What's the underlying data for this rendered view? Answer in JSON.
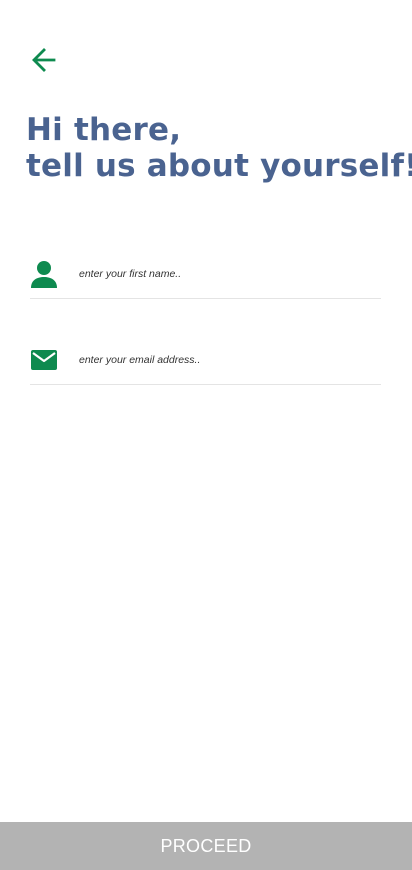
{
  "header": {
    "back_icon": "arrow-left-icon"
  },
  "heading": {
    "line1": "Hi there,",
    "line2": "tell us about yourself!"
  },
  "form": {
    "first_name": {
      "icon": "person-icon",
      "value": "",
      "placeholder": "enter your first name.."
    },
    "email": {
      "icon": "envelope-icon",
      "value": "",
      "placeholder": "enter your email address.."
    }
  },
  "footer": {
    "proceed_label": "PROCEED"
  },
  "colors": {
    "accent_green": "#0e8a4f",
    "heading_blue": "#4a6390",
    "button_disabled_gray": "#b3b3b3",
    "divider": "#e4e4e4"
  }
}
